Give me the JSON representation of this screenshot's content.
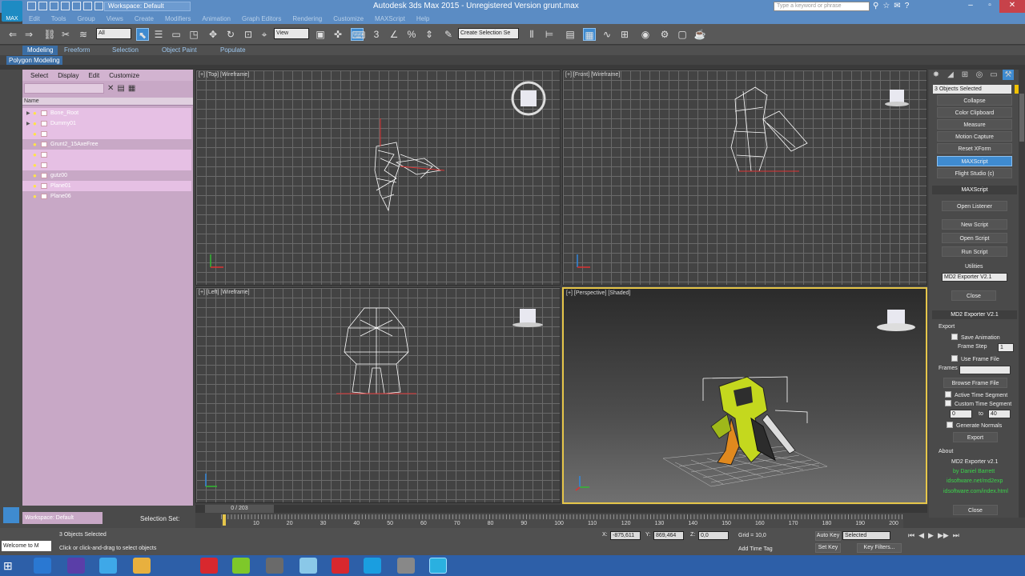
{
  "titlebar": {
    "logo": "MAX",
    "workspace": "Workspace: Default",
    "app_title": "Autodesk 3ds Max  2015   -  Unregistered Version    grunt.max",
    "search_placeholder": "Type a keyword or phrase"
  },
  "menu": [
    "Edit",
    "Tools",
    "Group",
    "Views",
    "Create",
    "Modifiers",
    "Animation",
    "Graph Editors",
    "Rendering",
    "Customize",
    "MAXScript",
    "Help"
  ],
  "toolbar": {
    "filter": "All",
    "view": "View",
    "selection_set": "Create Selection Se"
  },
  "ribbon": {
    "tabs": [
      "Modeling",
      "Freeform",
      "Selection",
      "Object Paint",
      "Populate"
    ],
    "subtab": "Polygon Modeling"
  },
  "explorer": {
    "menus": [
      "Select",
      "Display",
      "Edit",
      "Customize"
    ],
    "column": "Name",
    "items": [
      {
        "name": "Bone_Root",
        "expandable": true,
        "highlight": true
      },
      {
        "name": "Dummy01",
        "expandable": true,
        "highlight": true
      },
      {
        "name": "",
        "expandable": false,
        "highlight": true
      },
      {
        "name": "Grunt2_15AxeFree",
        "expandable": false,
        "highlight": false
      },
      {
        "name": "",
        "expandable": false,
        "highlight": true
      },
      {
        "name": "",
        "expandable": false,
        "highlight": true
      },
      {
        "name": "gutz00",
        "expandable": false,
        "highlight": false
      },
      {
        "name": "Plane01",
        "expandable": false,
        "highlight": true
      },
      {
        "name": "Plane06",
        "expandable": false,
        "highlight": false
      }
    ]
  },
  "viewports": {
    "top": "[+] [Top] [Wireframe]",
    "front": "[+] [Front] [Wireframe]",
    "left": "[+] [Left] [Wireframe]",
    "persp": "[+] [Perspective] [Shaded]"
  },
  "command_panel": {
    "selection": "3 Objects Selected",
    "utility_buttons": [
      "Collapse",
      "Color Clipboard",
      "Measure",
      "Motion Capture",
      "Reset XForm",
      "MAXScript",
      "Flight Studio (c)"
    ],
    "maxscript_rollout": "MAXScript",
    "maxscript_buttons": [
      "Open Listener",
      "New Script",
      "Open Script",
      "Run Script"
    ],
    "utilities_label": "Utilities",
    "utilities_value": "MD2 Exporter V2.1",
    "close": "Close",
    "exporter_rollout": "MD2 Exporter V2.1",
    "export_label": "Export",
    "save_animation": "Save Animation",
    "frame_step": "Frame Step",
    "frame_step_value": "1",
    "use_frame_file": "Use Frame File",
    "frames_label": "Frames",
    "browse_frame_file": "Browse Frame File",
    "active_time_segment": "Active Time Segment",
    "custom_time_segment": "Custom Time Segment",
    "range_from": "0",
    "range_to_label": "to",
    "range_to": "40",
    "generate_normals": "Generate Normals",
    "export_btn": "Export",
    "about_label": "About",
    "about_title": "MD2 Exporter v2.1",
    "about_lines": [
      "by Daniel Barrett",
      "idsoftware.net/md2exp",
      "idsoftware.com/index.html"
    ],
    "close2": "Close"
  },
  "timeline": {
    "thumb": "0 / 203",
    "ticks": [
      "10",
      "20",
      "30",
      "40",
      "50",
      "60",
      "70",
      "80",
      "90",
      "100",
      "110",
      "120",
      "130",
      "140",
      "150",
      "160",
      "170",
      "180",
      "190",
      "200"
    ]
  },
  "status": {
    "workspace": "Workspace: Default",
    "selection_set": "Selection Set:",
    "listener": "Welcome to M",
    "selected": "3 Objects Selected",
    "prompt": "Click or click-and-drag to select objects",
    "x_label": "X:",
    "x": "-875,611",
    "y_label": "Y:",
    "y": "869,464",
    "z_label": "Z:",
    "z": "0,0",
    "grid": "Grid = 10,0",
    "add_time_tag": "Add Time Tag",
    "auto_key": "Auto Key",
    "set_key": "Set Key",
    "selected_combo": "Selected",
    "key_filters": "Key Filters..."
  }
}
